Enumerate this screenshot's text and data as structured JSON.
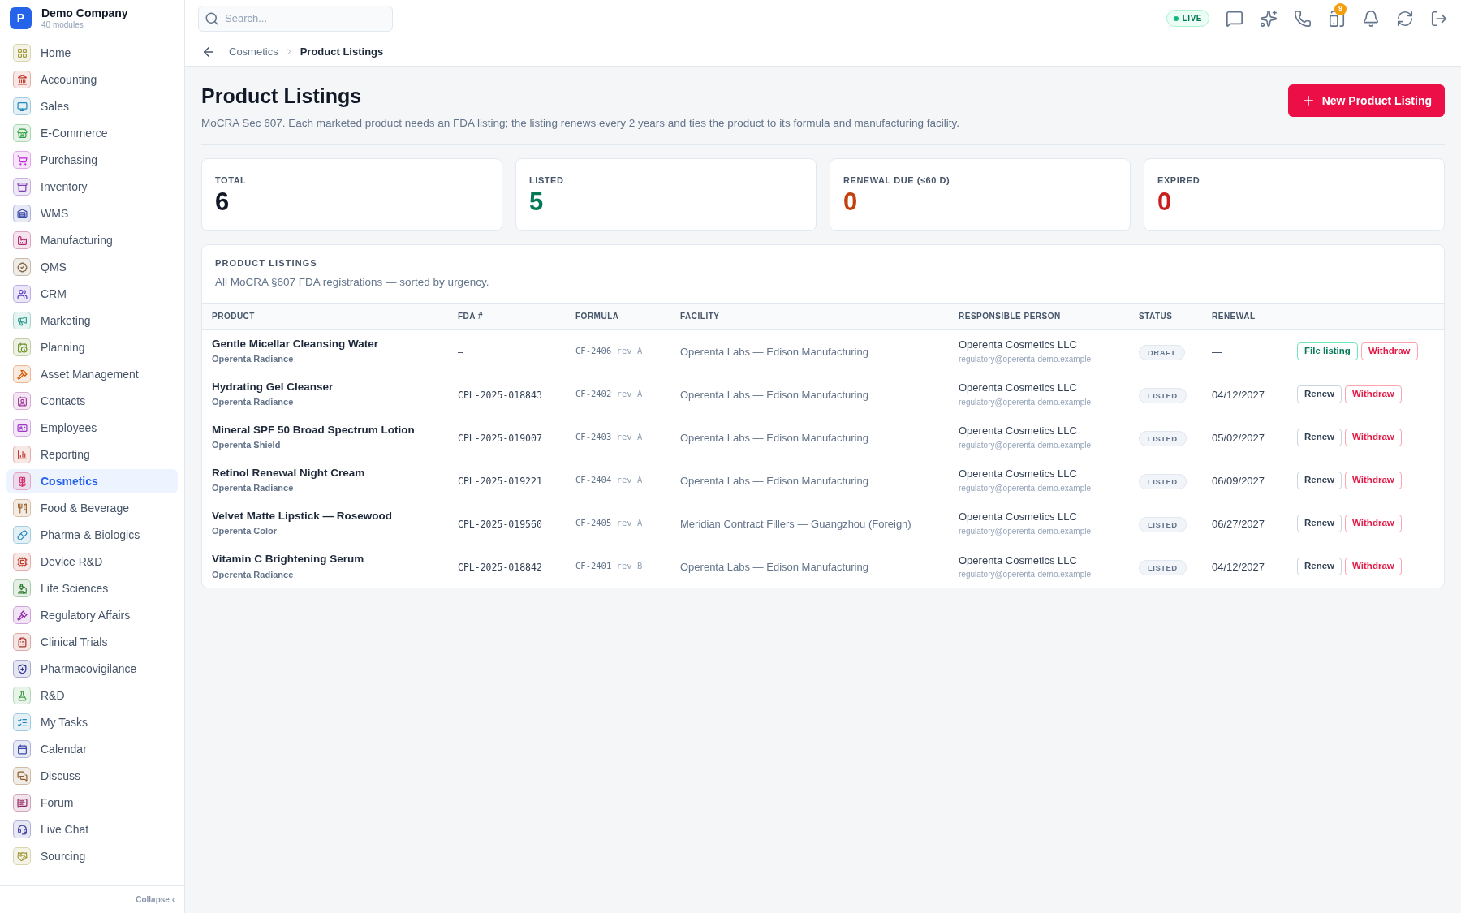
{
  "company": {
    "initial": "P",
    "name": "Demo Company",
    "subtitle": "40 modules"
  },
  "sidebar": {
    "items": [
      {
        "label": "Home",
        "color": "#a39a3a",
        "selected": false
      },
      {
        "label": "Accounting",
        "color": "#c0392b",
        "selected": false
      },
      {
        "label": "Sales",
        "color": "#1f86b8",
        "selected": false
      },
      {
        "label": "E-Commerce",
        "color": "#2e9e3e",
        "selected": false
      },
      {
        "label": "Purchasing",
        "color": "#c026d3",
        "selected": false
      },
      {
        "label": "Inventory",
        "color": "#7e3fb5",
        "selected": false
      },
      {
        "label": "WMS",
        "color": "#3949ab",
        "selected": false
      },
      {
        "label": "Manufacturing",
        "color": "#b0246c",
        "selected": false
      },
      {
        "label": "QMS",
        "color": "#7a5a36",
        "selected": false
      },
      {
        "label": "CRM",
        "color": "#5b3cc4",
        "selected": false
      },
      {
        "label": "Marketing",
        "color": "#2a9d8f",
        "selected": false
      },
      {
        "label": "Planning",
        "color": "#6b8e23",
        "selected": false
      },
      {
        "label": "Asset Management",
        "color": "#d35400",
        "selected": false
      },
      {
        "label": "Contacts",
        "color": "#a23c9b",
        "selected": false
      },
      {
        "label": "Employees",
        "color": "#9b36c9",
        "selected": false
      },
      {
        "label": "Reporting",
        "color": "#c0392b",
        "selected": false
      },
      {
        "label": "Cosmetics",
        "color": "#d6336c",
        "selected": true
      },
      {
        "label": "Food & Beverage",
        "color": "#a0622d",
        "selected": false
      },
      {
        "label": "Pharma & Biologics",
        "color": "#1f86b8",
        "selected": false
      },
      {
        "label": "Device R&D",
        "color": "#c0392b",
        "selected": false
      },
      {
        "label": "Life Sciences",
        "color": "#2e7d32",
        "selected": false
      },
      {
        "label": "Regulatory Affairs",
        "color": "#8e24aa",
        "selected": false
      },
      {
        "label": "Clinical Trials",
        "color": "#a93226",
        "selected": false
      },
      {
        "label": "Pharmacovigilance",
        "color": "#283593",
        "selected": false
      },
      {
        "label": "R&D",
        "color": "#43a047",
        "selected": false
      },
      {
        "label": "My Tasks",
        "color": "#1f86b8",
        "selected": false
      },
      {
        "label": "Calendar",
        "color": "#3949ab",
        "selected": false
      },
      {
        "label": "Discuss",
        "color": "#8d5a2b",
        "selected": false
      },
      {
        "label": "Forum",
        "color": "#8e2460",
        "selected": false
      },
      {
        "label": "Live Chat",
        "color": "#3f3fa8",
        "selected": false
      },
      {
        "label": "Sourcing",
        "color": "#a39a3a",
        "selected": false
      }
    ],
    "collapse": "Collapse ‹"
  },
  "search": {
    "placeholder": "Search..."
  },
  "topbar": {
    "live": "LIVE",
    "badge": "9"
  },
  "breadcrumb": [
    "Cosmetics",
    "Product Listings"
  ],
  "page": {
    "title": "Product Listings",
    "subtitle": "MoCRA Sec 607. Each marketed product needs an FDA listing; the listing renews every 2 years and ties the product to its formula and manufacturing facility.",
    "new_button": "New Product Listing"
  },
  "stats": [
    {
      "label": "TOTAL",
      "value": "6",
      "color": "#111827"
    },
    {
      "label": "LISTED",
      "value": "5",
      "color": "#047857"
    },
    {
      "label": "RENEWAL DUE (≤60 D)",
      "value": "0",
      "color": "#c2410c"
    },
    {
      "label": "EXPIRED",
      "value": "0",
      "color": "#c81e1e"
    }
  ],
  "table": {
    "title": "PRODUCT LISTINGS",
    "subtitle": "All MoCRA §607 FDA registrations — sorted by urgency.",
    "columns": [
      "PRODUCT",
      "FDA #",
      "FORMULA",
      "FACILITY",
      "RESPONSIBLE PERSON",
      "STATUS",
      "RENEWAL"
    ],
    "rows": [
      {
        "product": "Gentle Micellar Cleansing Water",
        "brand": "Operenta Radiance",
        "fda": "—",
        "formula": "CF-2406",
        "rev": "rev A",
        "facility": "Operenta Labs — Edison Manufacturing",
        "person": "Operenta Cosmetics LLC",
        "email": "regulatory@operenta-demo.example",
        "status": "DRAFT",
        "renewal": "—",
        "actions": [
          {
            "label": "File listing",
            "kind": "file"
          },
          {
            "label": "Withdraw",
            "kind": "withdraw"
          }
        ]
      },
      {
        "product": "Hydrating Gel Cleanser",
        "brand": "Operenta Radiance",
        "fda": "CPL-2025-018843",
        "formula": "CF-2402",
        "rev": "rev A",
        "facility": "Operenta Labs — Edison Manufacturing",
        "person": "Operenta Cosmetics LLC",
        "email": "regulatory@operenta-demo.example",
        "status": "LISTED",
        "renewal": "04/12/2027",
        "actions": [
          {
            "label": "Renew",
            "kind": "renew"
          },
          {
            "label": "Withdraw",
            "kind": "withdraw"
          }
        ]
      },
      {
        "product": "Mineral SPF 50 Broad Spectrum Lotion",
        "brand": "Operenta Shield",
        "fda": "CPL-2025-019007",
        "formula": "CF-2403",
        "rev": "rev A",
        "facility": "Operenta Labs — Edison Manufacturing",
        "person": "Operenta Cosmetics LLC",
        "email": "regulatory@operenta-demo.example",
        "status": "LISTED",
        "renewal": "05/02/2027",
        "actions": [
          {
            "label": "Renew",
            "kind": "renew"
          },
          {
            "label": "Withdraw",
            "kind": "withdraw"
          }
        ]
      },
      {
        "product": "Retinol Renewal Night Cream",
        "brand": "Operenta Radiance",
        "fda": "CPL-2025-019221",
        "formula": "CF-2404",
        "rev": "rev A",
        "facility": "Operenta Labs — Edison Manufacturing",
        "person": "Operenta Cosmetics LLC",
        "email": "regulatory@operenta-demo.example",
        "status": "LISTED",
        "renewal": "06/09/2027",
        "actions": [
          {
            "label": "Renew",
            "kind": "renew"
          },
          {
            "label": "Withdraw",
            "kind": "withdraw"
          }
        ]
      },
      {
        "product": "Velvet Matte Lipstick — Rosewood",
        "brand": "Operenta Color",
        "fda": "CPL-2025-019560",
        "formula": "CF-2405",
        "rev": "rev A",
        "facility": "Meridian Contract Fillers — Guangzhou (Foreign)",
        "person": "Operenta Cosmetics LLC",
        "email": "regulatory@operenta-demo.example",
        "status": "LISTED",
        "renewal": "06/27/2027",
        "actions": [
          {
            "label": "Renew",
            "kind": "renew"
          },
          {
            "label": "Withdraw",
            "kind": "withdraw"
          }
        ]
      },
      {
        "product": "Vitamin C Brightening Serum",
        "brand": "Operenta Radiance",
        "fda": "CPL-2025-018842",
        "formula": "CF-2401",
        "rev": "rev B",
        "facility": "Operenta Labs — Edison Manufacturing",
        "person": "Operenta Cosmetics LLC",
        "email": "regulatory@operenta-demo.example",
        "status": "LISTED",
        "renewal": "04/12/2027",
        "actions": [
          {
            "label": "Renew",
            "kind": "renew"
          },
          {
            "label": "Withdraw",
            "kind": "withdraw"
          }
        ]
      }
    ]
  }
}
